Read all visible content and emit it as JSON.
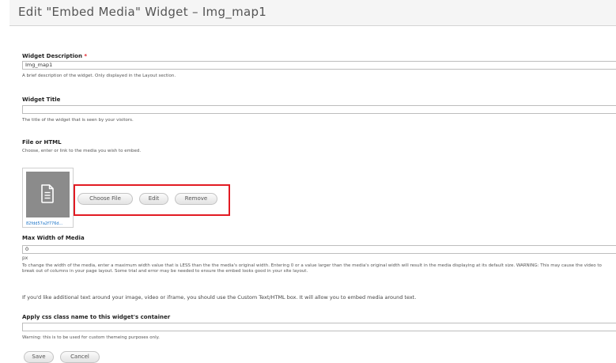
{
  "header": {
    "title": "Edit \"Embed Media\" Widget – Img_map1"
  },
  "widget_description": {
    "label": "Widget Description",
    "required_mark": "*",
    "value": "Img_map1",
    "help": "A brief description of the widget. Only displayed in the Layout section."
  },
  "widget_title": {
    "label": "Widget Title",
    "value": "",
    "help": "The title of the widget that is seen by your visitors."
  },
  "file_or_html": {
    "label": "File or HTML",
    "help": "Choose, enter or link to the media you wish to embed.",
    "file_name": "82fdd57a2f776d...",
    "icon": "document-icon",
    "buttons": {
      "choose_file": "Choose File",
      "edit": "Edit",
      "remove": "Remove"
    },
    "highlight_color": "#e21b23"
  },
  "max_width": {
    "label": "Max Width of Media",
    "value": "0",
    "unit": "px",
    "help": "To change the width of the media, enter a maximum width value that is LESS than the the media's original width. Entering 0 or a value larger than the media's original width will result in the media displaying at its default size. WARNING: This may cause the video to break out of columns in your page layout. Some trial and error may be needed to ensure the embed looks good in your site layout."
  },
  "note": "If you'd like additional text around your image, video or iframe, you should use the Custom Text/HTML box. It will allow you to embed media around text.",
  "css_class": {
    "label": "Apply css class name to this widget's container",
    "value": "",
    "help": "Warning: this is to be used for custom themeing purposes only."
  },
  "footer": {
    "save": "Save",
    "cancel": "Cancel"
  }
}
